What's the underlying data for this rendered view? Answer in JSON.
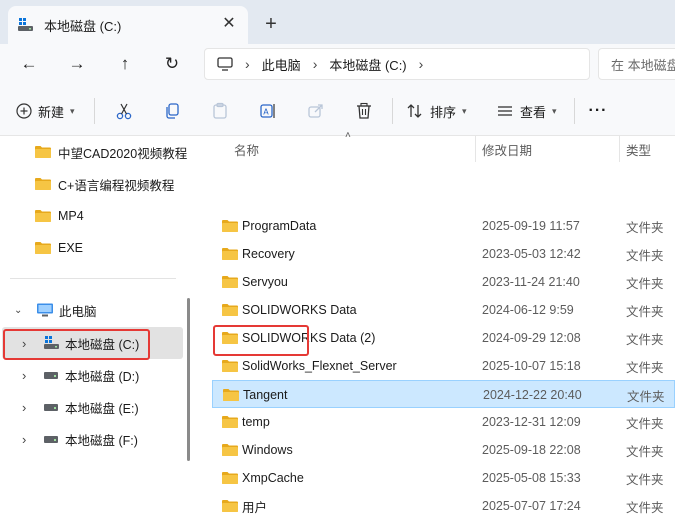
{
  "colors": {
    "folder": "#f6c544",
    "folder_dark": "#e7a91c",
    "accent": "#005fb8",
    "selection": "#cce8ff",
    "highlight_box": "#e53935"
  },
  "tab": {
    "title": "本地磁盘 (C:)",
    "close": "✕",
    "new_tab": "+"
  },
  "nav": {
    "back": "←",
    "forward": "→",
    "up": "↑",
    "refresh": "↻",
    "breadcrumb": [
      "此电脑",
      "本地磁盘 (C:)"
    ],
    "search_placeholder": "在 本地磁盘"
  },
  "toolbar": {
    "new_label": "新建",
    "sort_label": "排序",
    "view_label": "查看",
    "more": "···"
  },
  "sidebar": {
    "folders": [
      {
        "label": "中望CAD2020视频教程"
      },
      {
        "label": "C+语言编程视频教程"
      },
      {
        "label": "MP4"
      },
      {
        "label": "EXE"
      }
    ],
    "this_pc": "此电脑",
    "drives": [
      {
        "label": "本地磁盘 (C:)",
        "selected": true
      },
      {
        "label": "本地磁盘 (D:)"
      },
      {
        "label": "本地磁盘 (E:)"
      },
      {
        "label": "本地磁盘 (F:)"
      }
    ]
  },
  "columns": {
    "name": "名称",
    "modified": "修改日期",
    "type": "类型"
  },
  "files": [
    {
      "name": "ProgramData",
      "modified": "2025-09-19 11:57",
      "type": "文件夹"
    },
    {
      "name": "Recovery",
      "modified": "2023-05-03 12:42",
      "type": "文件夹"
    },
    {
      "name": "Servyou",
      "modified": "2023-11-24 21:40",
      "type": "文件夹"
    },
    {
      "name": "SOLIDWORKS Data",
      "modified": "2024-06-12 9:59",
      "type": "文件夹"
    },
    {
      "name": "SOLIDWORKS Data (2)",
      "modified": "2024-09-29 12:08",
      "type": "文件夹"
    },
    {
      "name": "SolidWorks_Flexnet_Server",
      "modified": "2025-10-07 15:18",
      "type": "文件夹"
    },
    {
      "name": "Tangent",
      "modified": "2024-12-22 20:40",
      "type": "文件夹",
      "selected": true
    },
    {
      "name": "temp",
      "modified": "2023-12-31 12:09",
      "type": "文件夹"
    },
    {
      "name": "Windows",
      "modified": "2025-09-18 22:08",
      "type": "文件夹"
    },
    {
      "name": "XmpCache",
      "modified": "2025-05-08 15:33",
      "type": "文件夹"
    },
    {
      "name": "用户",
      "modified": "2025-07-07 17:24",
      "type": "文件夹"
    }
  ]
}
